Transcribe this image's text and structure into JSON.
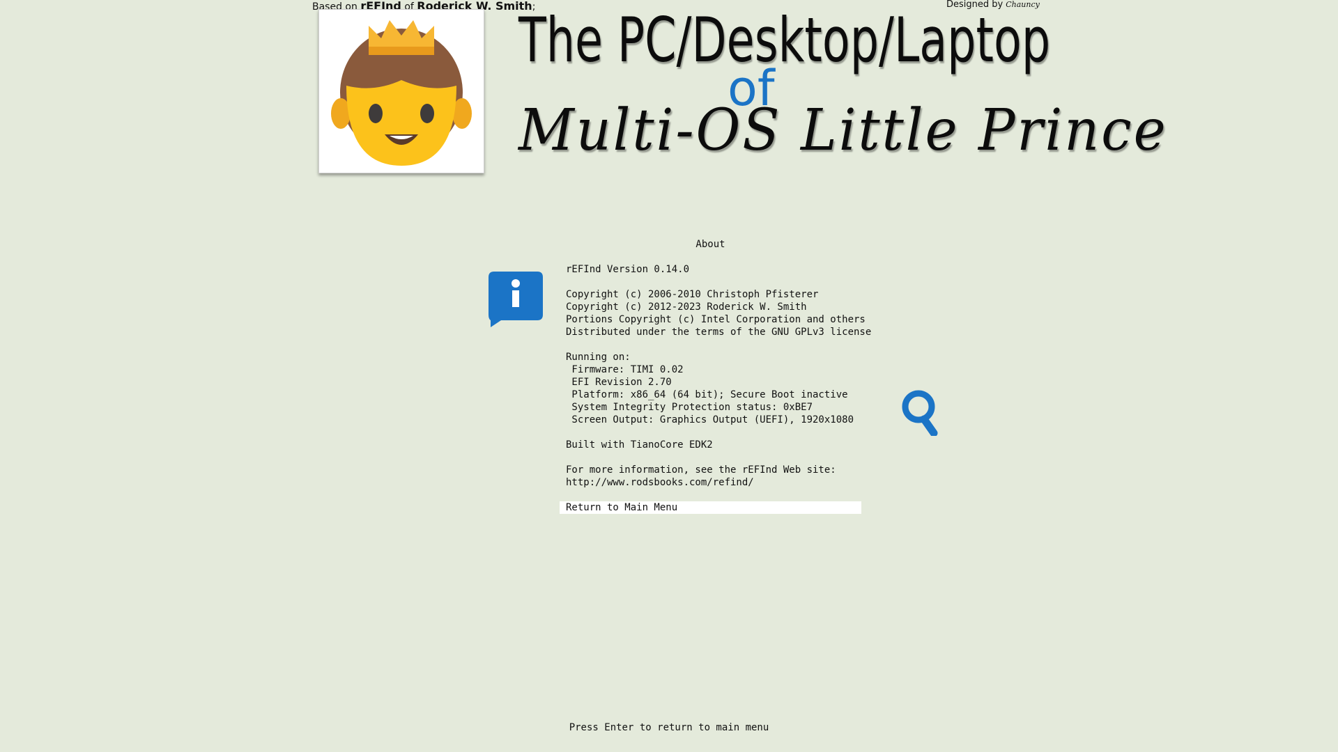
{
  "header": {
    "credit_left": {
      "prefix": "Based on",
      "product": "rEFInd",
      "of": "of",
      "author": "Roderick W. Smith",
      "suffix": ";"
    },
    "credit_right": {
      "label": "Designed by",
      "signature": "Chauncy"
    },
    "title_line1": "The PC/Desktop/Laptop",
    "title_of": "of",
    "title_line3": "Multi-OS Little Prince"
  },
  "colors": {
    "background": "#e4eadb",
    "accent_blue": "#1b74c6",
    "highlight": "#ffffff"
  },
  "icons": {
    "portrait": "prince-emoji-icon",
    "info": "info-icon",
    "search": "search-icon"
  },
  "about": {
    "title": "About",
    "lines": [
      "rEFInd Version 0.14.0",
      "",
      "Copyright (c) 2006-2010 Christoph Pfisterer",
      "Copyright (c) 2012-2023 Roderick W. Smith",
      "Portions Copyright (c) Intel Corporation and others",
      "Distributed under the terms of the GNU GPLv3 license",
      "",
      "Running on:",
      " Firmware: TIMI 0.02",
      " EFI Revision 2.70",
      " Platform: x86_64 (64 bit); Secure Boot inactive",
      " System Integrity Protection status: 0xBE7",
      " Screen Output: Graphics Output (UEFI), 1920x1080",
      "",
      "Built with TianoCore EDK2",
      "",
      "For more information, see the rEFInd Web site:",
      "http://www.rodsbooks.com/refind/",
      ""
    ],
    "menu_item": "Return to Main Menu"
  },
  "hint": "Press Enter to return to main menu"
}
